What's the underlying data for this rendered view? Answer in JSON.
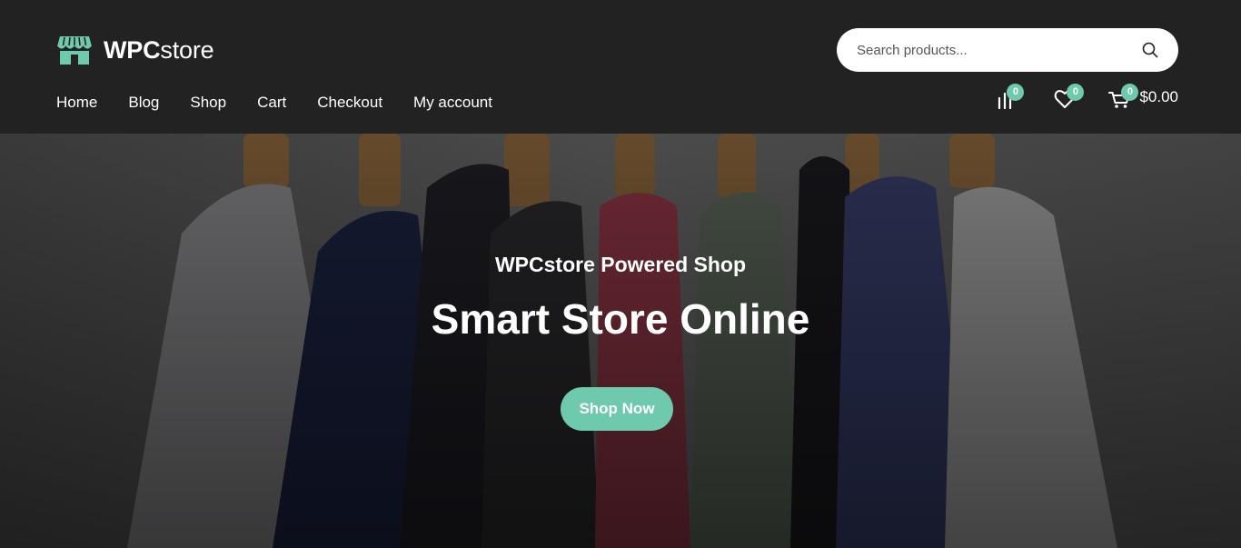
{
  "brand": {
    "name_bold": "WPC",
    "name_light": "store",
    "accent_color": "#6ec9ad"
  },
  "search": {
    "placeholder": "Search products..."
  },
  "nav": {
    "items": [
      {
        "label": "Home"
      },
      {
        "label": "Blog"
      },
      {
        "label": "Shop"
      },
      {
        "label": "Cart"
      },
      {
        "label": "Checkout"
      },
      {
        "label": "My account"
      }
    ]
  },
  "header_icons": {
    "compare": {
      "icon": "compare-icon",
      "count": "0"
    },
    "wishlist": {
      "icon": "heart-icon",
      "count": "0"
    },
    "cart": {
      "icon": "cart-icon",
      "count": "0",
      "total": "$0.00"
    }
  },
  "hero": {
    "subtitle": "WPCstore Powered Shop",
    "title": "Smart Store Online",
    "button_label": "Shop Now"
  }
}
